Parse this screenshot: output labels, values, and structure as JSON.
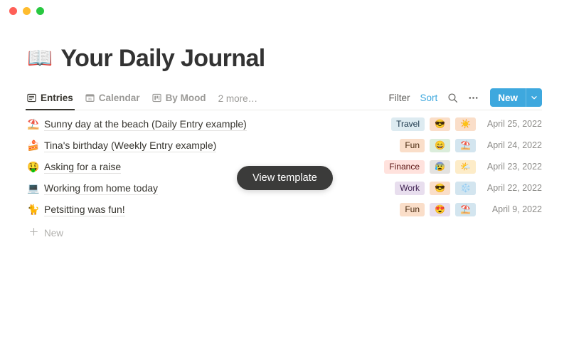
{
  "window": {
    "traffic_lights": [
      {
        "name": "close",
        "color": "#ff5f57"
      },
      {
        "name": "minimize",
        "color": "#febc2e"
      },
      {
        "name": "zoom",
        "color": "#28c840"
      }
    ]
  },
  "header": {
    "emoji": "📖",
    "title": "Your Daily Journal"
  },
  "tabs": [
    {
      "label": "Entries",
      "icon": "list-view-icon",
      "active": true
    },
    {
      "label": "Calendar",
      "icon": "calendar-icon",
      "active": false
    },
    {
      "label": "By Mood",
      "icon": "board-view-icon",
      "active": false
    }
  ],
  "tabs_more_label": "2 more…",
  "toolbar": {
    "filter_label": "Filter",
    "sort_label": "Sort",
    "sort_color": "#3ea8de",
    "search_icon": "search-icon",
    "more_icon": "ellipsis-icon",
    "new_label": "New",
    "new_caret_icon": "chevron-down-icon",
    "new_color": "#3ea8de"
  },
  "overlay": {
    "view_template_label": "View template"
  },
  "table": {
    "rows": [
      {
        "emoji": "⛱️",
        "title": "Sunny day at the beach (Daily Entry example)",
        "tag": {
          "label": "Travel",
          "bg": "#ddebf1",
          "fg": "#183347"
        },
        "mood": {
          "emoji": "😎",
          "bg": "#fadec9"
        },
        "weather": {
          "emoji": "☀️",
          "bg": "#fadec9"
        },
        "date": "April 25, 2022"
      },
      {
        "emoji": "🍰",
        "title": "Tina's birthday (Weekly Entry example)",
        "tag": {
          "label": "Fun",
          "bg": "#fadec9",
          "fg": "#49290e"
        },
        "mood": {
          "emoji": "😄",
          "bg": "#dbeddb"
        },
        "weather": {
          "emoji": "⛱️",
          "bg": "#d3e5ef"
        },
        "date": "April 24, 2022"
      },
      {
        "emoji": "🤑",
        "title": "Asking for a raise",
        "tag": {
          "label": "Finance",
          "bg": "#ffe2dd",
          "fg": "#5d1715"
        },
        "mood": {
          "emoji": "😰",
          "bg": "#e3e2e0"
        },
        "weather": {
          "emoji": "🌤️",
          "bg": "#fdecc8"
        },
        "date": "April 23, 2022"
      },
      {
        "emoji": "💻",
        "title": "Working from home today",
        "tag": {
          "label": "Work",
          "bg": "#e8deee",
          "fg": "#412454"
        },
        "mood": {
          "emoji": "😎",
          "bg": "#fadec9"
        },
        "weather": {
          "emoji": "❄️",
          "bg": "#d3e5ef"
        },
        "date": "April 22, 2022"
      },
      {
        "emoji": "🐈",
        "title": "Petsitting was fun!",
        "tag": {
          "label": "Fun",
          "bg": "#fadec9",
          "fg": "#49290e"
        },
        "mood": {
          "emoji": "😍",
          "bg": "#e8deee"
        },
        "weather": {
          "emoji": "⛱️",
          "bg": "#d3e5ef"
        },
        "date": "April 9, 2022"
      }
    ],
    "new_row_label": "New"
  }
}
